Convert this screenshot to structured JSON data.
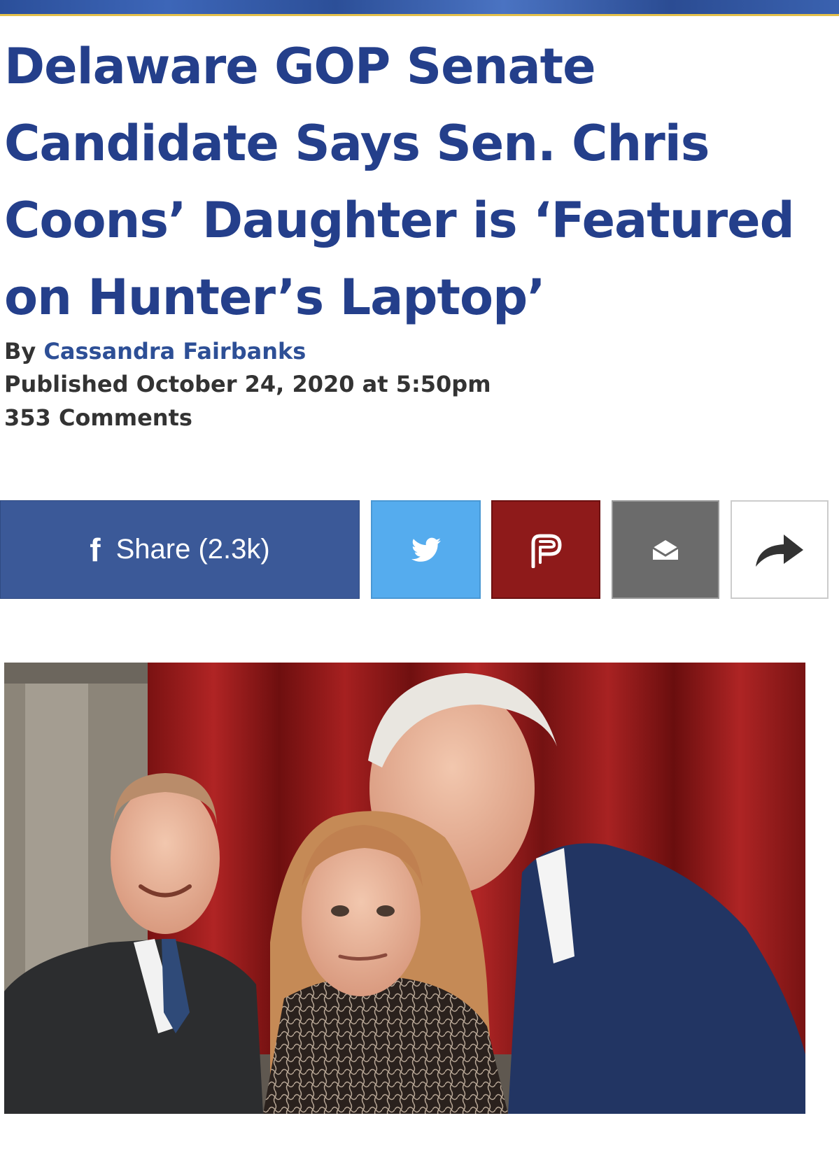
{
  "article": {
    "headline": "Delaware GOP Senate Candidate Says Sen. Chris Coons’ Daughter is ‘Featured on Hunter’s Laptop’",
    "by_label": "By",
    "author": "Cassandra Fairbanks",
    "published": "Published October 24, 2020 at 5:50pm",
    "comments": "353 Comments"
  },
  "share": {
    "facebook_icon": "f",
    "facebook_label": "Share (2.3k)",
    "icons": [
      "facebook-icon",
      "twitter-icon",
      "parler-icon",
      "email-icon",
      "share-arrow-icon"
    ]
  },
  "colors": {
    "headline": "#243f8b",
    "author": "#2d4f96",
    "facebook": "#3b5998",
    "twitter": "#55acee",
    "parler": "#8e1a1a",
    "email": "#6b6b6b"
  }
}
